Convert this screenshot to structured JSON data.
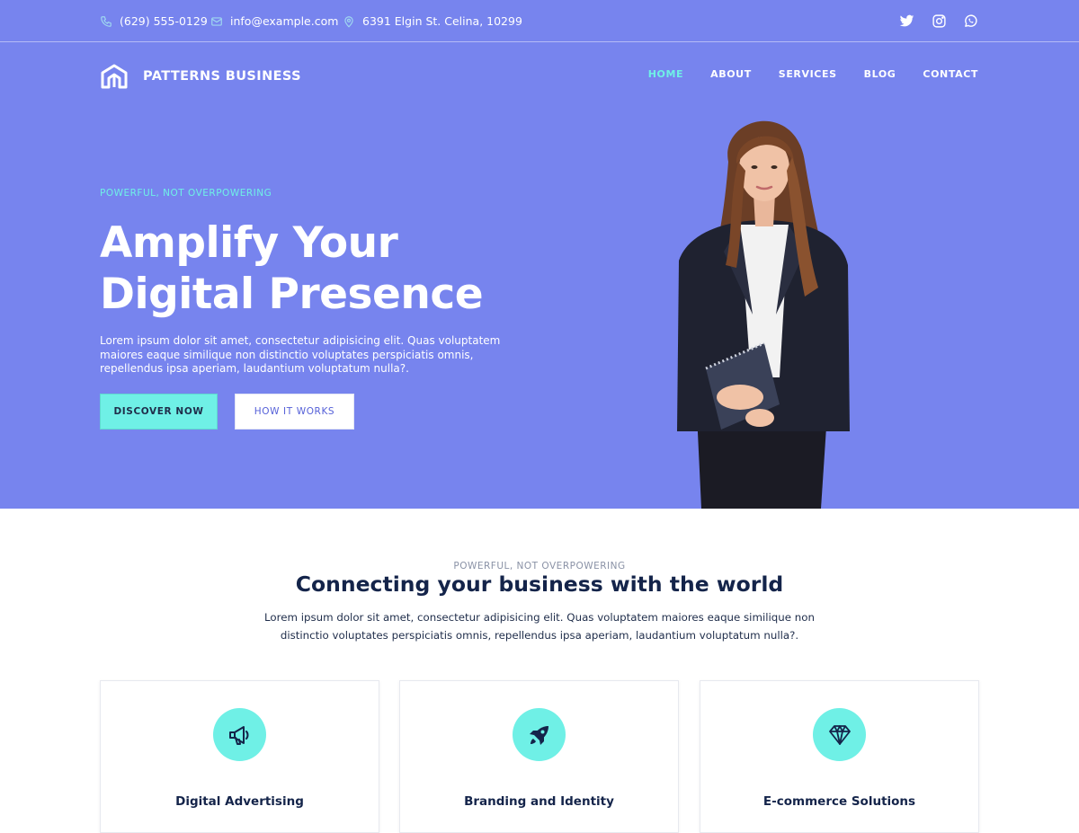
{
  "colors": {
    "hero_background": "#7784ee",
    "accent": "#6ff0e6",
    "heading_dark": "#14244a",
    "white": "#ffffff"
  },
  "topbar": {
    "phone": "(629) 555-0129",
    "phone_icon": "phone-icon",
    "email": "info@example.com",
    "email_icon": "envelope-icon",
    "address": "6391 Elgin St. Celina, 10299",
    "address_icon": "map-pin-icon",
    "social": [
      "twitter-icon",
      "instagram-icon",
      "whatsapp-icon"
    ]
  },
  "header": {
    "logo_text": "PATTERNS BUSINESS",
    "logo_icon": "logo-icon",
    "nav": [
      "HOME",
      "ABOUT",
      "SERVICES",
      "BLOG",
      "CONTACT"
    ],
    "active_nav": "HOME"
  },
  "hero": {
    "eyebrow": "POWERFUL, NOT OVERPOWERING",
    "headline_line1": "Amplify Your",
    "headline_line2": "Digital Presence",
    "text": "Lorem ipsum dolor sit amet, consectetur adipisicing elit. Quas voluptatem maiores eaque similique non distinctio voluptates perspiciatis omnis, repellendus ipsa aperiam, laudantium voluptatum nulla?.",
    "primary_button": "DISCOVER NOW",
    "secondary_button": "HOW IT WORKS"
  },
  "section": {
    "eyebrow": "POWERFUL, NOT OVERPOWERING",
    "title": "Connecting your business with the world",
    "text": "Lorem ipsum dolor sit amet, consectetur adipisicing elit. Quas voluptatem maiores eaque similique non distinctio voluptates perspiciatis omnis, repellendus ipsa aperiam, laudantium voluptatum nulla?."
  },
  "cards": [
    {
      "title": "Digital Advertising",
      "icon": "megaphone-icon"
    },
    {
      "title": "Branding and Identity",
      "icon": "rocket-icon"
    },
    {
      "title": "E-commerce Solutions",
      "icon": "diamond-icon"
    }
  ]
}
